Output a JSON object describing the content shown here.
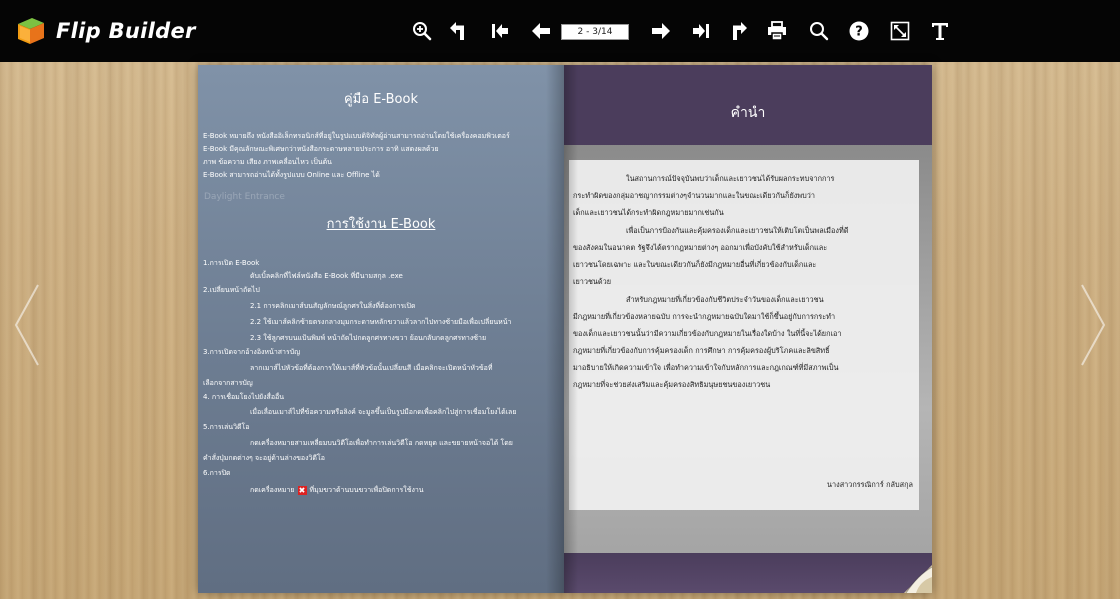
{
  "app": {
    "title": "Flip Builder"
  },
  "toolbar": {
    "page_value": "2 - 3/14",
    "icons": [
      "zoom-in-icon",
      "back-icon",
      "first-page-icon",
      "previous-page-icon",
      "next-page-icon",
      "last-page-icon",
      "share-icon",
      "print-icon",
      "search-icon",
      "help-icon",
      "fullscreen-icon",
      "text-icon"
    ]
  },
  "left_page": {
    "heading": "คู่มือ E-Book",
    "intro": [
      "E-Book หมายถึง หนังสืออิเล็กทรอนิกส์ที่อยู่ในรูปแบบดิจิทัลผู้อ่านสามารถอ่านโดยใช้เครื่องคอมพิวเตอร์",
      "E-Book มีคุณลักษณะพิเศษกว่าหนังสือกระดาษหลายประการ อาทิ แสดงผลด้วย",
      "ภาพ ข้อความ เสียง ภาพเคลื่อนไหว เป็นต้น",
      "E-Book สามารถอ่านได้ทั้งรูปแบบ Online และ Offline ได้"
    ],
    "faded_text": "Daylight Entrance",
    "usage_heading": "การใช้งาน E-Book",
    "items": [
      "1.การเปิด E-Book",
      "ดับเบิ้ลคลิกที่ไฟล์หนังสือ E-Book ที่มีนามสกุล .exe",
      "2.เปลี่ยนหน้าถัดไป",
      "2.1 การคลิกเมาส์บนสัญลักษณ์ลูกศรในสิ่งที่ต้องการเปิด",
      "2.2 ใช้เมาส์คลิกซ้ายตรงกลางมุมกระดาษหลักขวาแล้วลากไปทางซ้ายมือเพื่อเปลี่ยนหน้า",
      "2.3 ใช้ลูกศรบนแป้นพิมพ์ หน้าถัดไปกดลูกศรทางขวา ย้อนกลับกดลูกศรทางซ้าย",
      "3.การเปิดจากอ้างอิงหน้าสารบัญ",
      "ลากเมาส์ไปหัวข้อที่ต้องการให้เมาส์ที่หัวข้อนั้นเปลี่ยนสี เมื่อคลิกจะเปิดหน้าหัวข้อที่",
      "เลือกจากสารบัญ",
      "4. การเชื่อมโยงไปยังสื่ออื่น",
      "เมื่อเลื่อนเมาส์ไปที่ข้อความหรือลิงค์ จะมูลขึ้นเป็นรูปมือกดเพื่อคลิกไปสู่การเชื่อมโยงได้เลย",
      "5.การเล่นวิดีโอ",
      "กดเครื่องหมายสามเหลี่ยมบนวิดีโอเพื่อทำการเล่นวิดีโอ กดหยุด และขยายหน้าจอได้ โดย",
      "คำสั่งปุ่มกดต่างๆ จะอยู่ด้านล่างของวิดีโอ",
      "6.การปิด",
      "กดเครื่องหมาย",
      "ที่มุมขวาด้านบนขวาเพื่อปิดการใช้งาน"
    ]
  },
  "right_page": {
    "heading": "คำนำ",
    "lines": [
      "ในสถานการณ์ปัจจุบันพบว่าเด็กและเยาวชนได้รับผลกระทบจากการ",
      "กระทำผิดของกลุ่มอาชญากรรมต่างๆจำนวนมากและในขณะเดียวกันก็ยังพบว่า",
      "เด็กและเยาวชนได้กระทำผิดกฎหมายมากเช่นกัน",
      "เพื่อเป็นการป้องกันและคุ้มครองเด็กและเยาวชนให้เติบโตเป็นพลเมืองที่ดี",
      "ของสังคมในอนาคต รัฐจึงได้ตรากฎหมายต่างๆ ออกมาเพื่อบังคับใช้สำหรับเด็กและ",
      "เยาวชนโดยเฉพาะ และในขณะเดียวกันก็ยังมีกฎหมายอื่นที่เกี่ยวข้องกับเด็กและ",
      "เยาวชนด้วย",
      "สำหรับกฎหมายที่เกี่ยวข้องกับชีวิตประจำวันของเด็กและเยาวชน",
      "มีกฎหมายที่เกี่ยวข้องหลายฉบับ การจะนำกฎหมายฉบับใดมาใช้ก็ขึ้นอยู่กับการกระทำ",
      "ของเด็กและเยาวชนนั้นว่ามีความเกี่ยวข้องกับกฎหมายในเรื่องใดบ้าง ในที่นี้จะได้ยกเอา",
      "กฎหมายที่เกี่ยวข้องกับการคุ้มครองเด็ก การศึกษา การคุ้มครองผู้บริโภคและลิขสิทธิ์",
      "มาอธิบายให้เกิดความเข้าใจ เพื่อทำความเข้าใจกับหลักการและกฎเกณฑ์ที่มีสภาพเป็น",
      "กฎหมายที่จะช่วยส่งเสริมและคุ้มครองสิทธิมนุษยชนของเยาวชน"
    ],
    "signature": "นางสาวกรรณิการ์ กลับสกุล"
  },
  "colors": {
    "toolbar": "#050505",
    "purple_band": "#4b3d5c",
    "left_page": "#738399"
  }
}
